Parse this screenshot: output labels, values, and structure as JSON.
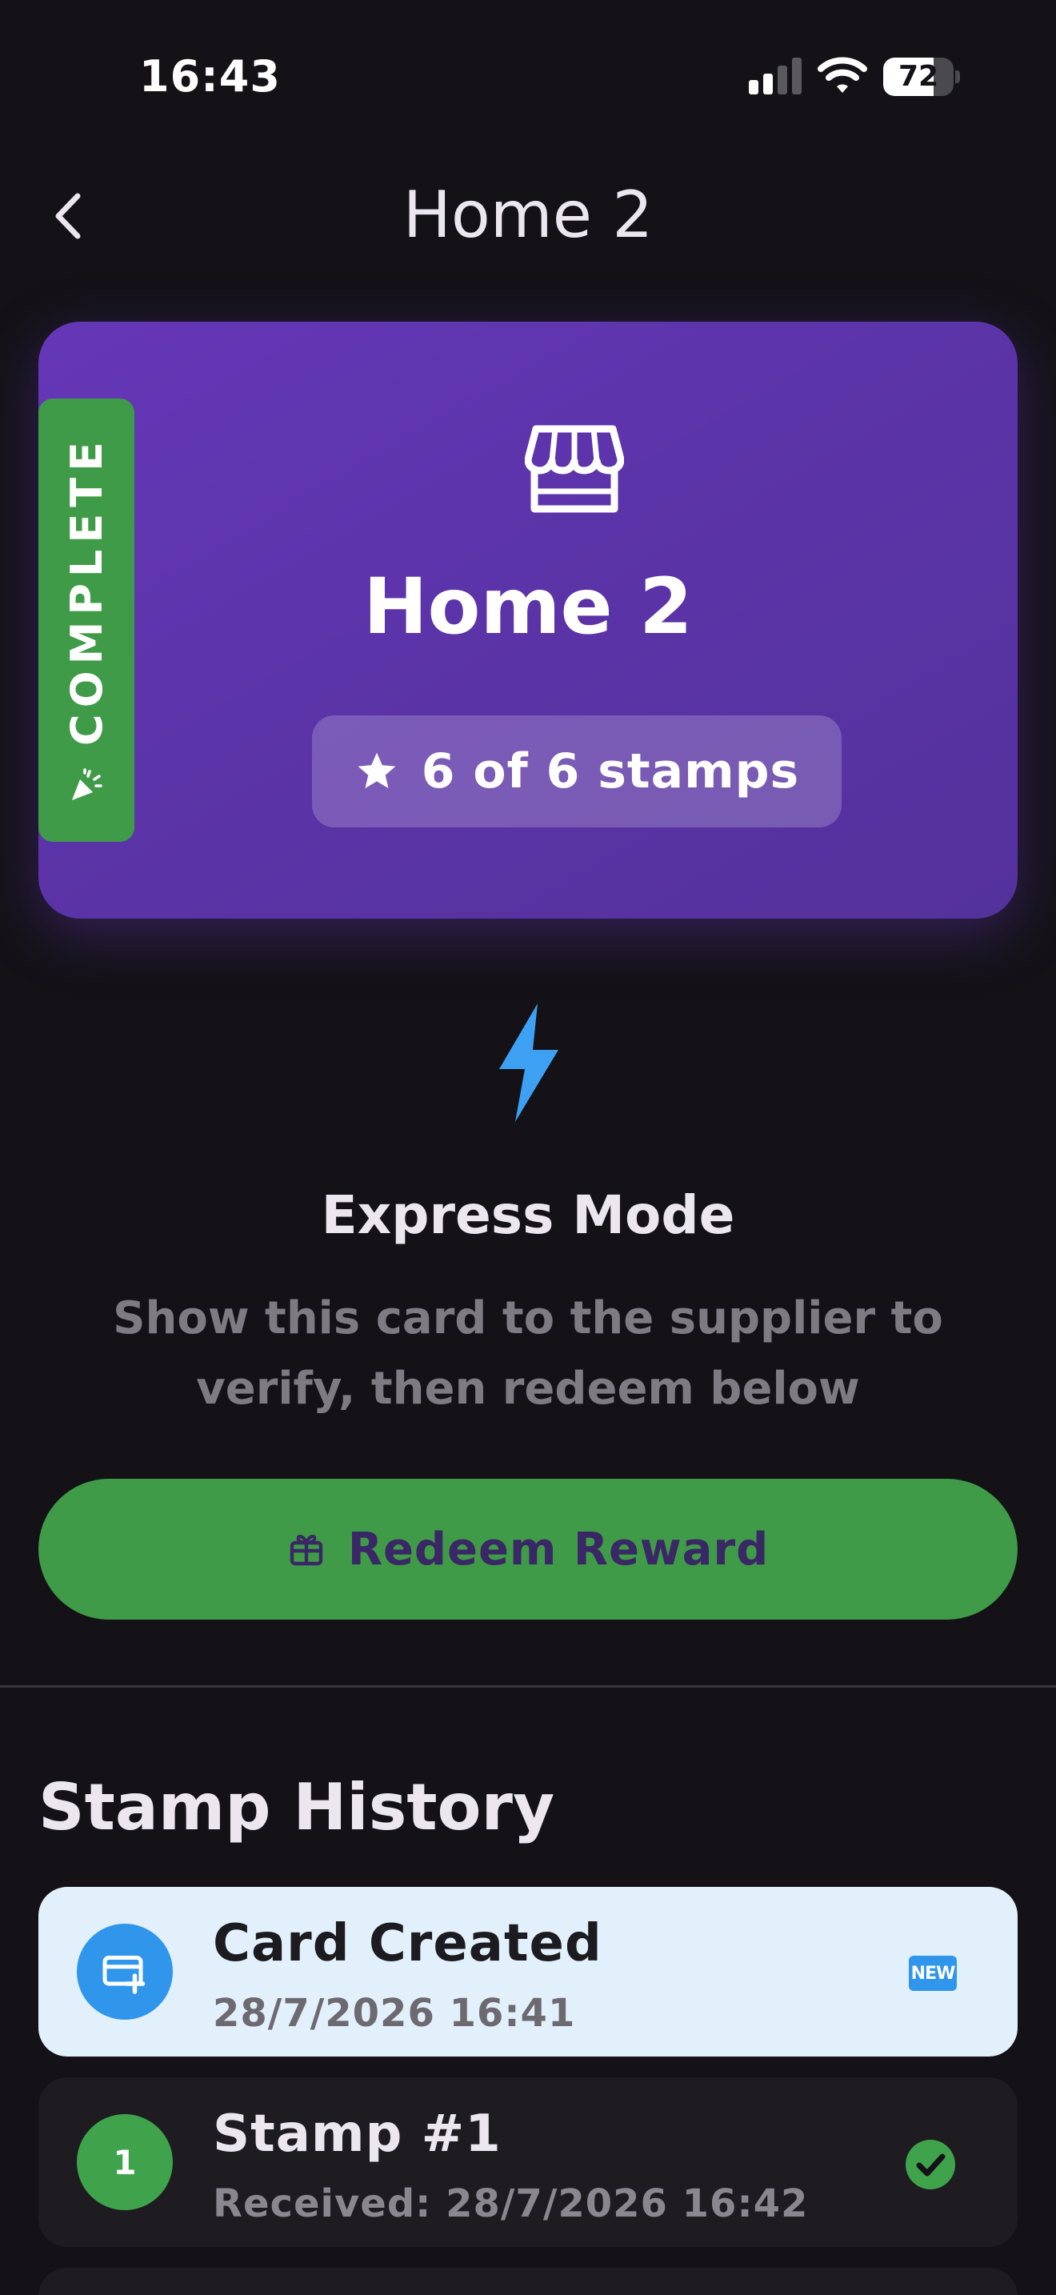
{
  "status_bar": {
    "time": "16:43",
    "battery": "72",
    "battery_level": 0.72
  },
  "header": {
    "title": "Home 2"
  },
  "card": {
    "title": "Home 2",
    "stamps_label": "6 of 6 stamps",
    "stamps_collected": 6,
    "stamps_total": 6,
    "ribbon": "COMPLETE",
    "icon": "store-icon",
    "gradient": [
      "#6537b8",
      "#54329c"
    ]
  },
  "express": {
    "title": "Express Mode",
    "description": "Show this card to the supplier to verify, then redeem below",
    "icon": "lightning-bolt-icon",
    "icon_color": "#3ea0f2"
  },
  "redeem": {
    "label": "Redeem Reward",
    "icon": "gift-icon",
    "color": "#3f9b47"
  },
  "history": {
    "title": "Stamp History",
    "items": [
      {
        "title": "Card Created",
        "subtitle": "28/7/2026 16:41",
        "icon": "card-add-icon",
        "badge": "NEW"
      },
      {
        "number": "1",
        "title": "Stamp #1",
        "subtitle": "Received: 28/7/2026 16:42",
        "status_icon": "check-circle-icon"
      }
    ]
  }
}
